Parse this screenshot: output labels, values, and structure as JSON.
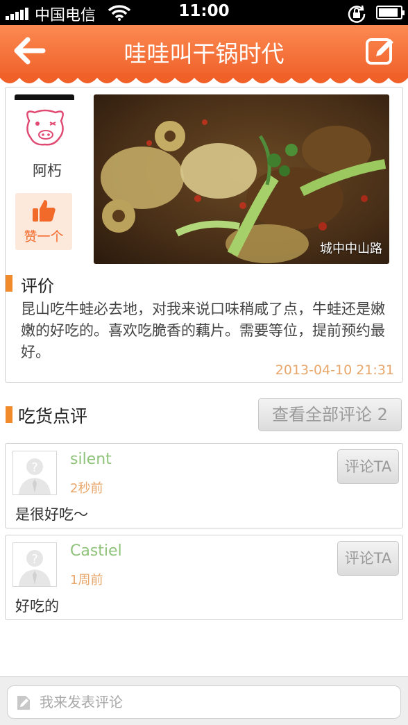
{
  "status_bar": {
    "carrier": "中国电信",
    "time": "11:00",
    "icons": [
      "signal-icon",
      "wifi-icon",
      "rotation-lock-icon",
      "battery-icon"
    ],
    "battery_level": 0.9
  },
  "nav": {
    "title": "哇哇叫干锅时代",
    "back_icon": "back-arrow-icon",
    "edit_icon": "edit-icon"
  },
  "review": {
    "username": "阿朽",
    "like_label": "赞一个",
    "photo_location": "城中中山路",
    "heading": "评价",
    "text": "昆山吃牛蛙必去地，对我来说口味稍咸了点，牛蛙还是嫩嫩的好吃的。喜欢吃脆香的藕片。需要等位，提前预约最好。",
    "date": "2013-04-10 21:31"
  },
  "comments_section": {
    "heading": "吃货点评",
    "view_all_label": "查看全部评论 2"
  },
  "comments": [
    {
      "author": "silent",
      "time": "2秒前",
      "text": "是很好吃～",
      "reply_label": "评论TA"
    },
    {
      "author": "Castiel",
      "time": "1周前",
      "text": "好吃的",
      "reply_label": "评论TA"
    }
  ],
  "input": {
    "placeholder": "我来发表评论"
  },
  "colors": {
    "nav_orange": "#f26a2a",
    "accent_orange": "#f08a2a",
    "author_green": "#8fc37a",
    "timestamp_orange": "#e8a66a"
  }
}
